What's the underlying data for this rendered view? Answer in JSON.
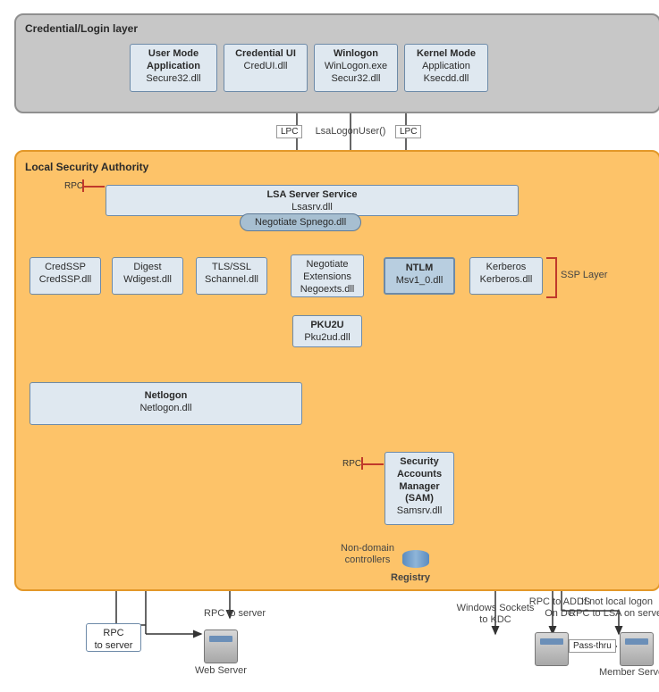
{
  "credLayer": {
    "title": "Credential/Login layer",
    "boxes": {
      "userMode": {
        "l1": "User Mode",
        "l2": "Application",
        "l3": "Secure32.dll"
      },
      "credUI": {
        "l1": "Credential UI",
        "l2": "CredUI.dll"
      },
      "winlogon": {
        "l1": "Winlogon",
        "l2": "WinLogon.exe",
        "l3": "Secur32.dll"
      },
      "kernel": {
        "l1": "Kernel Mode",
        "l2": "Application",
        "l3": "Ksecdd.dll"
      }
    }
  },
  "connectors": {
    "lpc1": "LPC",
    "lpc2": "LPC",
    "lsaLogon": "LsaLogonUser()"
  },
  "lsaLayer": {
    "title": "Local Security Authority",
    "rpc1": "RPC",
    "rpc2": "RPC",
    "lsaServer": {
      "l1": "LSA Server Service",
      "l2": "Lsasrv.dll"
    },
    "negotiate": "Negotiate Spnego.dll",
    "ssp": {
      "credssp": {
        "l1": "CredSSP",
        "l2": "CredSSP.dll"
      },
      "digest": {
        "l1": "Digest",
        "l2": "Wdigest.dll"
      },
      "tls": {
        "l1": "TLS/SSL",
        "l2": "Schannel.dll"
      },
      "negext": {
        "l1": "Negotiate",
        "l2": "Extensions",
        "l3": "Negoexts.dll"
      },
      "ntlm": {
        "l1": "NTLM",
        "l2": "Msv1_0.dll"
      },
      "kerberos": {
        "l1": "Kerberos",
        "l2": "Kerberos.dll"
      }
    },
    "sspLabel": "SSP Layer",
    "pku2u": {
      "l1": "PKU2U",
      "l2": "Pku2ud.dll"
    },
    "netlogon": {
      "l1": "Netlogon",
      "l2": "Netlogon.dll"
    },
    "sam": {
      "l1": "Security",
      "l2": "Accounts",
      "l3": "Manager",
      "l4": "(SAM)",
      "l5": "Samsrv.dll"
    },
    "nonDomain": "Non-domain\ncontrollers",
    "registry": "Registry"
  },
  "bottom": {
    "rpcToServerBox": "RPC\nto server",
    "rpcToServer": "RPC to server",
    "webServer": "Web Server",
    "winsock": "Windows Sockets\nto KDC",
    "rpcAdds": "RPC to ADDS\nOn DC",
    "passThru": "Pass-thru",
    "memberServer": "Member Server",
    "ifNot": "If not local logon\nRPC to LSA on server"
  }
}
